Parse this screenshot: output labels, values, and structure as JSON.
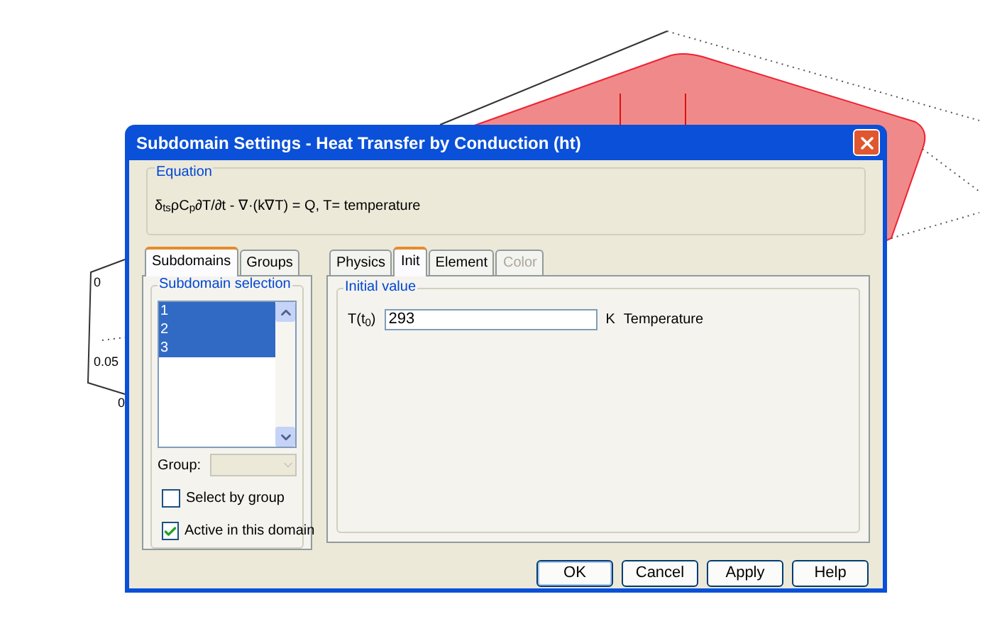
{
  "plot": {
    "axis_labels": [
      "0",
      "0.05",
      "0"
    ]
  },
  "dialog": {
    "title": "Subdomain Settings - Heat Transfer by Conduction (ht)",
    "equation": {
      "label": "Equation",
      "text": "δ$_{ts}$ρC$_{p}$∂T/∂t - ∇·(k∇T) = Q, T= temperature"
    },
    "left_tabs": [
      {
        "label": "Subdomains",
        "selected": true,
        "disabled": false
      },
      {
        "label": "Groups",
        "selected": false,
        "disabled": false
      }
    ],
    "subdomain_selection": {
      "label": "Subdomain selection",
      "items": [
        {
          "label": "1",
          "selected": true
        },
        {
          "label": "2",
          "selected": true
        },
        {
          "label": "3",
          "selected": true
        }
      ]
    },
    "group": {
      "label": "Group:",
      "disabled": true
    },
    "checkboxes": [
      {
        "label": "Select by group",
        "checked": false
      },
      {
        "label": "Active in this domain",
        "checked": true
      }
    ],
    "right_tabs": [
      {
        "label": "Physics",
        "selected": false,
        "disabled": false
      },
      {
        "label": "Init",
        "selected": true,
        "disabled": false
      },
      {
        "label": "Element",
        "selected": false,
        "disabled": false
      },
      {
        "label": "Color",
        "selected": false,
        "disabled": true
      }
    ],
    "initial_value": {
      "label": "Initial value",
      "symbol": "T(t$_{0}$)",
      "value": "293",
      "unit": "K",
      "description": "Temperature"
    },
    "buttons": [
      {
        "label": "OK",
        "default": true
      },
      {
        "label": "Cancel",
        "default": false
      },
      {
        "label": "Apply",
        "default": false
      },
      {
        "label": "Help",
        "default": false
      }
    ]
  }
}
